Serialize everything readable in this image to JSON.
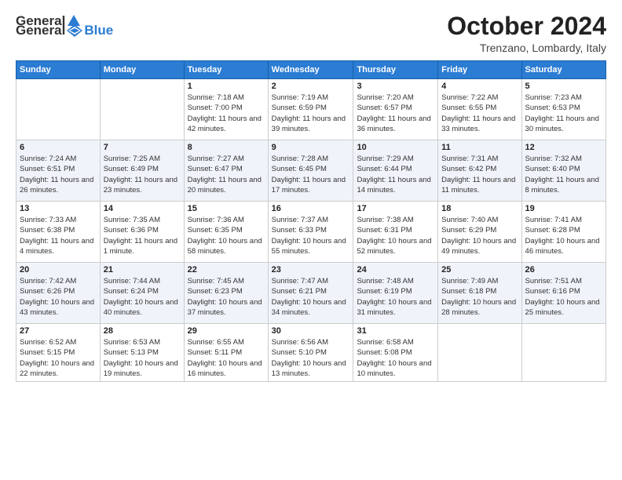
{
  "logo": {
    "general": "General",
    "blue": "Blue"
  },
  "header": {
    "month": "October 2024",
    "location": "Trenzano, Lombardy, Italy"
  },
  "weekdays": [
    "Sunday",
    "Monday",
    "Tuesday",
    "Wednesday",
    "Thursday",
    "Friday",
    "Saturday"
  ],
  "weeks": [
    [
      {
        "day": "",
        "sunrise": "",
        "sunset": "",
        "daylight": ""
      },
      {
        "day": "",
        "sunrise": "",
        "sunset": "",
        "daylight": ""
      },
      {
        "day": "1",
        "sunrise": "Sunrise: 7:18 AM",
        "sunset": "Sunset: 7:00 PM",
        "daylight": "Daylight: 11 hours and 42 minutes."
      },
      {
        "day": "2",
        "sunrise": "Sunrise: 7:19 AM",
        "sunset": "Sunset: 6:59 PM",
        "daylight": "Daylight: 11 hours and 39 minutes."
      },
      {
        "day": "3",
        "sunrise": "Sunrise: 7:20 AM",
        "sunset": "Sunset: 6:57 PM",
        "daylight": "Daylight: 11 hours and 36 minutes."
      },
      {
        "day": "4",
        "sunrise": "Sunrise: 7:22 AM",
        "sunset": "Sunset: 6:55 PM",
        "daylight": "Daylight: 11 hours and 33 minutes."
      },
      {
        "day": "5",
        "sunrise": "Sunrise: 7:23 AM",
        "sunset": "Sunset: 6:53 PM",
        "daylight": "Daylight: 11 hours and 30 minutes."
      }
    ],
    [
      {
        "day": "6",
        "sunrise": "Sunrise: 7:24 AM",
        "sunset": "Sunset: 6:51 PM",
        "daylight": "Daylight: 11 hours and 26 minutes."
      },
      {
        "day": "7",
        "sunrise": "Sunrise: 7:25 AM",
        "sunset": "Sunset: 6:49 PM",
        "daylight": "Daylight: 11 hours and 23 minutes."
      },
      {
        "day": "8",
        "sunrise": "Sunrise: 7:27 AM",
        "sunset": "Sunset: 6:47 PM",
        "daylight": "Daylight: 11 hours and 20 minutes."
      },
      {
        "day": "9",
        "sunrise": "Sunrise: 7:28 AM",
        "sunset": "Sunset: 6:45 PM",
        "daylight": "Daylight: 11 hours and 17 minutes."
      },
      {
        "day": "10",
        "sunrise": "Sunrise: 7:29 AM",
        "sunset": "Sunset: 6:44 PM",
        "daylight": "Daylight: 11 hours and 14 minutes."
      },
      {
        "day": "11",
        "sunrise": "Sunrise: 7:31 AM",
        "sunset": "Sunset: 6:42 PM",
        "daylight": "Daylight: 11 hours and 11 minutes."
      },
      {
        "day": "12",
        "sunrise": "Sunrise: 7:32 AM",
        "sunset": "Sunset: 6:40 PM",
        "daylight": "Daylight: 11 hours and 8 minutes."
      }
    ],
    [
      {
        "day": "13",
        "sunrise": "Sunrise: 7:33 AM",
        "sunset": "Sunset: 6:38 PM",
        "daylight": "Daylight: 11 hours and 4 minutes."
      },
      {
        "day": "14",
        "sunrise": "Sunrise: 7:35 AM",
        "sunset": "Sunset: 6:36 PM",
        "daylight": "Daylight: 11 hours and 1 minute."
      },
      {
        "day": "15",
        "sunrise": "Sunrise: 7:36 AM",
        "sunset": "Sunset: 6:35 PM",
        "daylight": "Daylight: 10 hours and 58 minutes."
      },
      {
        "day": "16",
        "sunrise": "Sunrise: 7:37 AM",
        "sunset": "Sunset: 6:33 PM",
        "daylight": "Daylight: 10 hours and 55 minutes."
      },
      {
        "day": "17",
        "sunrise": "Sunrise: 7:38 AM",
        "sunset": "Sunset: 6:31 PM",
        "daylight": "Daylight: 10 hours and 52 minutes."
      },
      {
        "day": "18",
        "sunrise": "Sunrise: 7:40 AM",
        "sunset": "Sunset: 6:29 PM",
        "daylight": "Daylight: 10 hours and 49 minutes."
      },
      {
        "day": "19",
        "sunrise": "Sunrise: 7:41 AM",
        "sunset": "Sunset: 6:28 PM",
        "daylight": "Daylight: 10 hours and 46 minutes."
      }
    ],
    [
      {
        "day": "20",
        "sunrise": "Sunrise: 7:42 AM",
        "sunset": "Sunset: 6:26 PM",
        "daylight": "Daylight: 10 hours and 43 minutes."
      },
      {
        "day": "21",
        "sunrise": "Sunrise: 7:44 AM",
        "sunset": "Sunset: 6:24 PM",
        "daylight": "Daylight: 10 hours and 40 minutes."
      },
      {
        "day": "22",
        "sunrise": "Sunrise: 7:45 AM",
        "sunset": "Sunset: 6:23 PM",
        "daylight": "Daylight: 10 hours and 37 minutes."
      },
      {
        "day": "23",
        "sunrise": "Sunrise: 7:47 AM",
        "sunset": "Sunset: 6:21 PM",
        "daylight": "Daylight: 10 hours and 34 minutes."
      },
      {
        "day": "24",
        "sunrise": "Sunrise: 7:48 AM",
        "sunset": "Sunset: 6:19 PM",
        "daylight": "Daylight: 10 hours and 31 minutes."
      },
      {
        "day": "25",
        "sunrise": "Sunrise: 7:49 AM",
        "sunset": "Sunset: 6:18 PM",
        "daylight": "Daylight: 10 hours and 28 minutes."
      },
      {
        "day": "26",
        "sunrise": "Sunrise: 7:51 AM",
        "sunset": "Sunset: 6:16 PM",
        "daylight": "Daylight: 10 hours and 25 minutes."
      }
    ],
    [
      {
        "day": "27",
        "sunrise": "Sunrise: 6:52 AM",
        "sunset": "Sunset: 5:15 PM",
        "daylight": "Daylight: 10 hours and 22 minutes."
      },
      {
        "day": "28",
        "sunrise": "Sunrise: 6:53 AM",
        "sunset": "Sunset: 5:13 PM",
        "daylight": "Daylight: 10 hours and 19 minutes."
      },
      {
        "day": "29",
        "sunrise": "Sunrise: 6:55 AM",
        "sunset": "Sunset: 5:11 PM",
        "daylight": "Daylight: 10 hours and 16 minutes."
      },
      {
        "day": "30",
        "sunrise": "Sunrise: 6:56 AM",
        "sunset": "Sunset: 5:10 PM",
        "daylight": "Daylight: 10 hours and 13 minutes."
      },
      {
        "day": "31",
        "sunrise": "Sunrise: 6:58 AM",
        "sunset": "Sunset: 5:08 PM",
        "daylight": "Daylight: 10 hours and 10 minutes."
      },
      {
        "day": "",
        "sunrise": "",
        "sunset": "",
        "daylight": ""
      },
      {
        "day": "",
        "sunrise": "",
        "sunset": "",
        "daylight": ""
      }
    ]
  ]
}
